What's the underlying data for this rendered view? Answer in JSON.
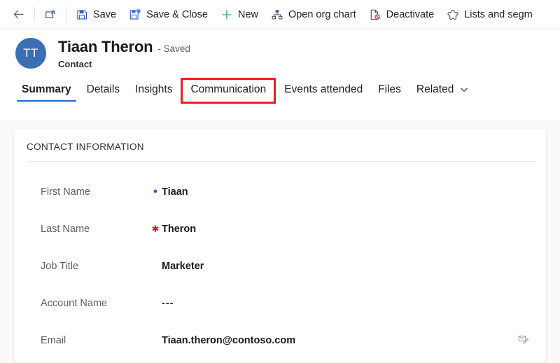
{
  "commandbar": {
    "items": [
      {
        "id": "back",
        "icon": "back-arrow-icon",
        "label": ""
      },
      {
        "id": "popout",
        "icon": "pop-out-icon",
        "label": ""
      },
      {
        "id": "save",
        "icon": "save-icon",
        "label": "Save"
      },
      {
        "id": "save-close",
        "icon": "save-close-icon",
        "label": "Save & Close"
      },
      {
        "id": "new",
        "icon": "plus-icon",
        "label": "New"
      },
      {
        "id": "org-chart",
        "icon": "org-chart-icon",
        "label": "Open org chart"
      },
      {
        "id": "deactivate",
        "icon": "deactivate-icon",
        "label": "Deactivate"
      },
      {
        "id": "lists",
        "icon": "lists-segments-icon",
        "label": "Lists and segm"
      }
    ]
  },
  "record": {
    "avatar_initials": "TT",
    "title": "Tiaan Theron",
    "status": "- Saved",
    "subtitle": "Contact",
    "avatar_color": "#3b6eb5"
  },
  "tabs": {
    "items": [
      {
        "label": "Summary",
        "active": true,
        "highlighted": false,
        "chevron": false
      },
      {
        "label": "Details",
        "active": false,
        "highlighted": false,
        "chevron": false
      },
      {
        "label": "Insights",
        "active": false,
        "highlighted": false,
        "chevron": false
      },
      {
        "label": "Communication",
        "active": false,
        "highlighted": true,
        "chevron": false
      },
      {
        "label": "Events attended",
        "active": false,
        "highlighted": false,
        "chevron": false
      },
      {
        "label": "Files",
        "active": false,
        "highlighted": false,
        "chevron": false
      },
      {
        "label": "Related",
        "active": false,
        "highlighted": false,
        "chevron": true
      }
    ],
    "active_underline_color": "#2266cc",
    "highlight_color": "#f01e1e"
  },
  "form": {
    "section_title": "CONTACT INFORMATION",
    "fields": [
      {
        "label": "First Name",
        "required": "recommended",
        "value": "Tiaan",
        "icon": ""
      },
      {
        "label": "Last Name",
        "required": "required",
        "value": "Theron",
        "icon": ""
      },
      {
        "label": "Job Title",
        "required": "none",
        "value": "Marketer",
        "icon": ""
      },
      {
        "label": "Account Name",
        "required": "none",
        "value": "---",
        "icon": ""
      },
      {
        "label": "Email",
        "required": "none",
        "value": "Tiaan.theron@contoso.com",
        "icon": "email-icon"
      }
    ]
  }
}
